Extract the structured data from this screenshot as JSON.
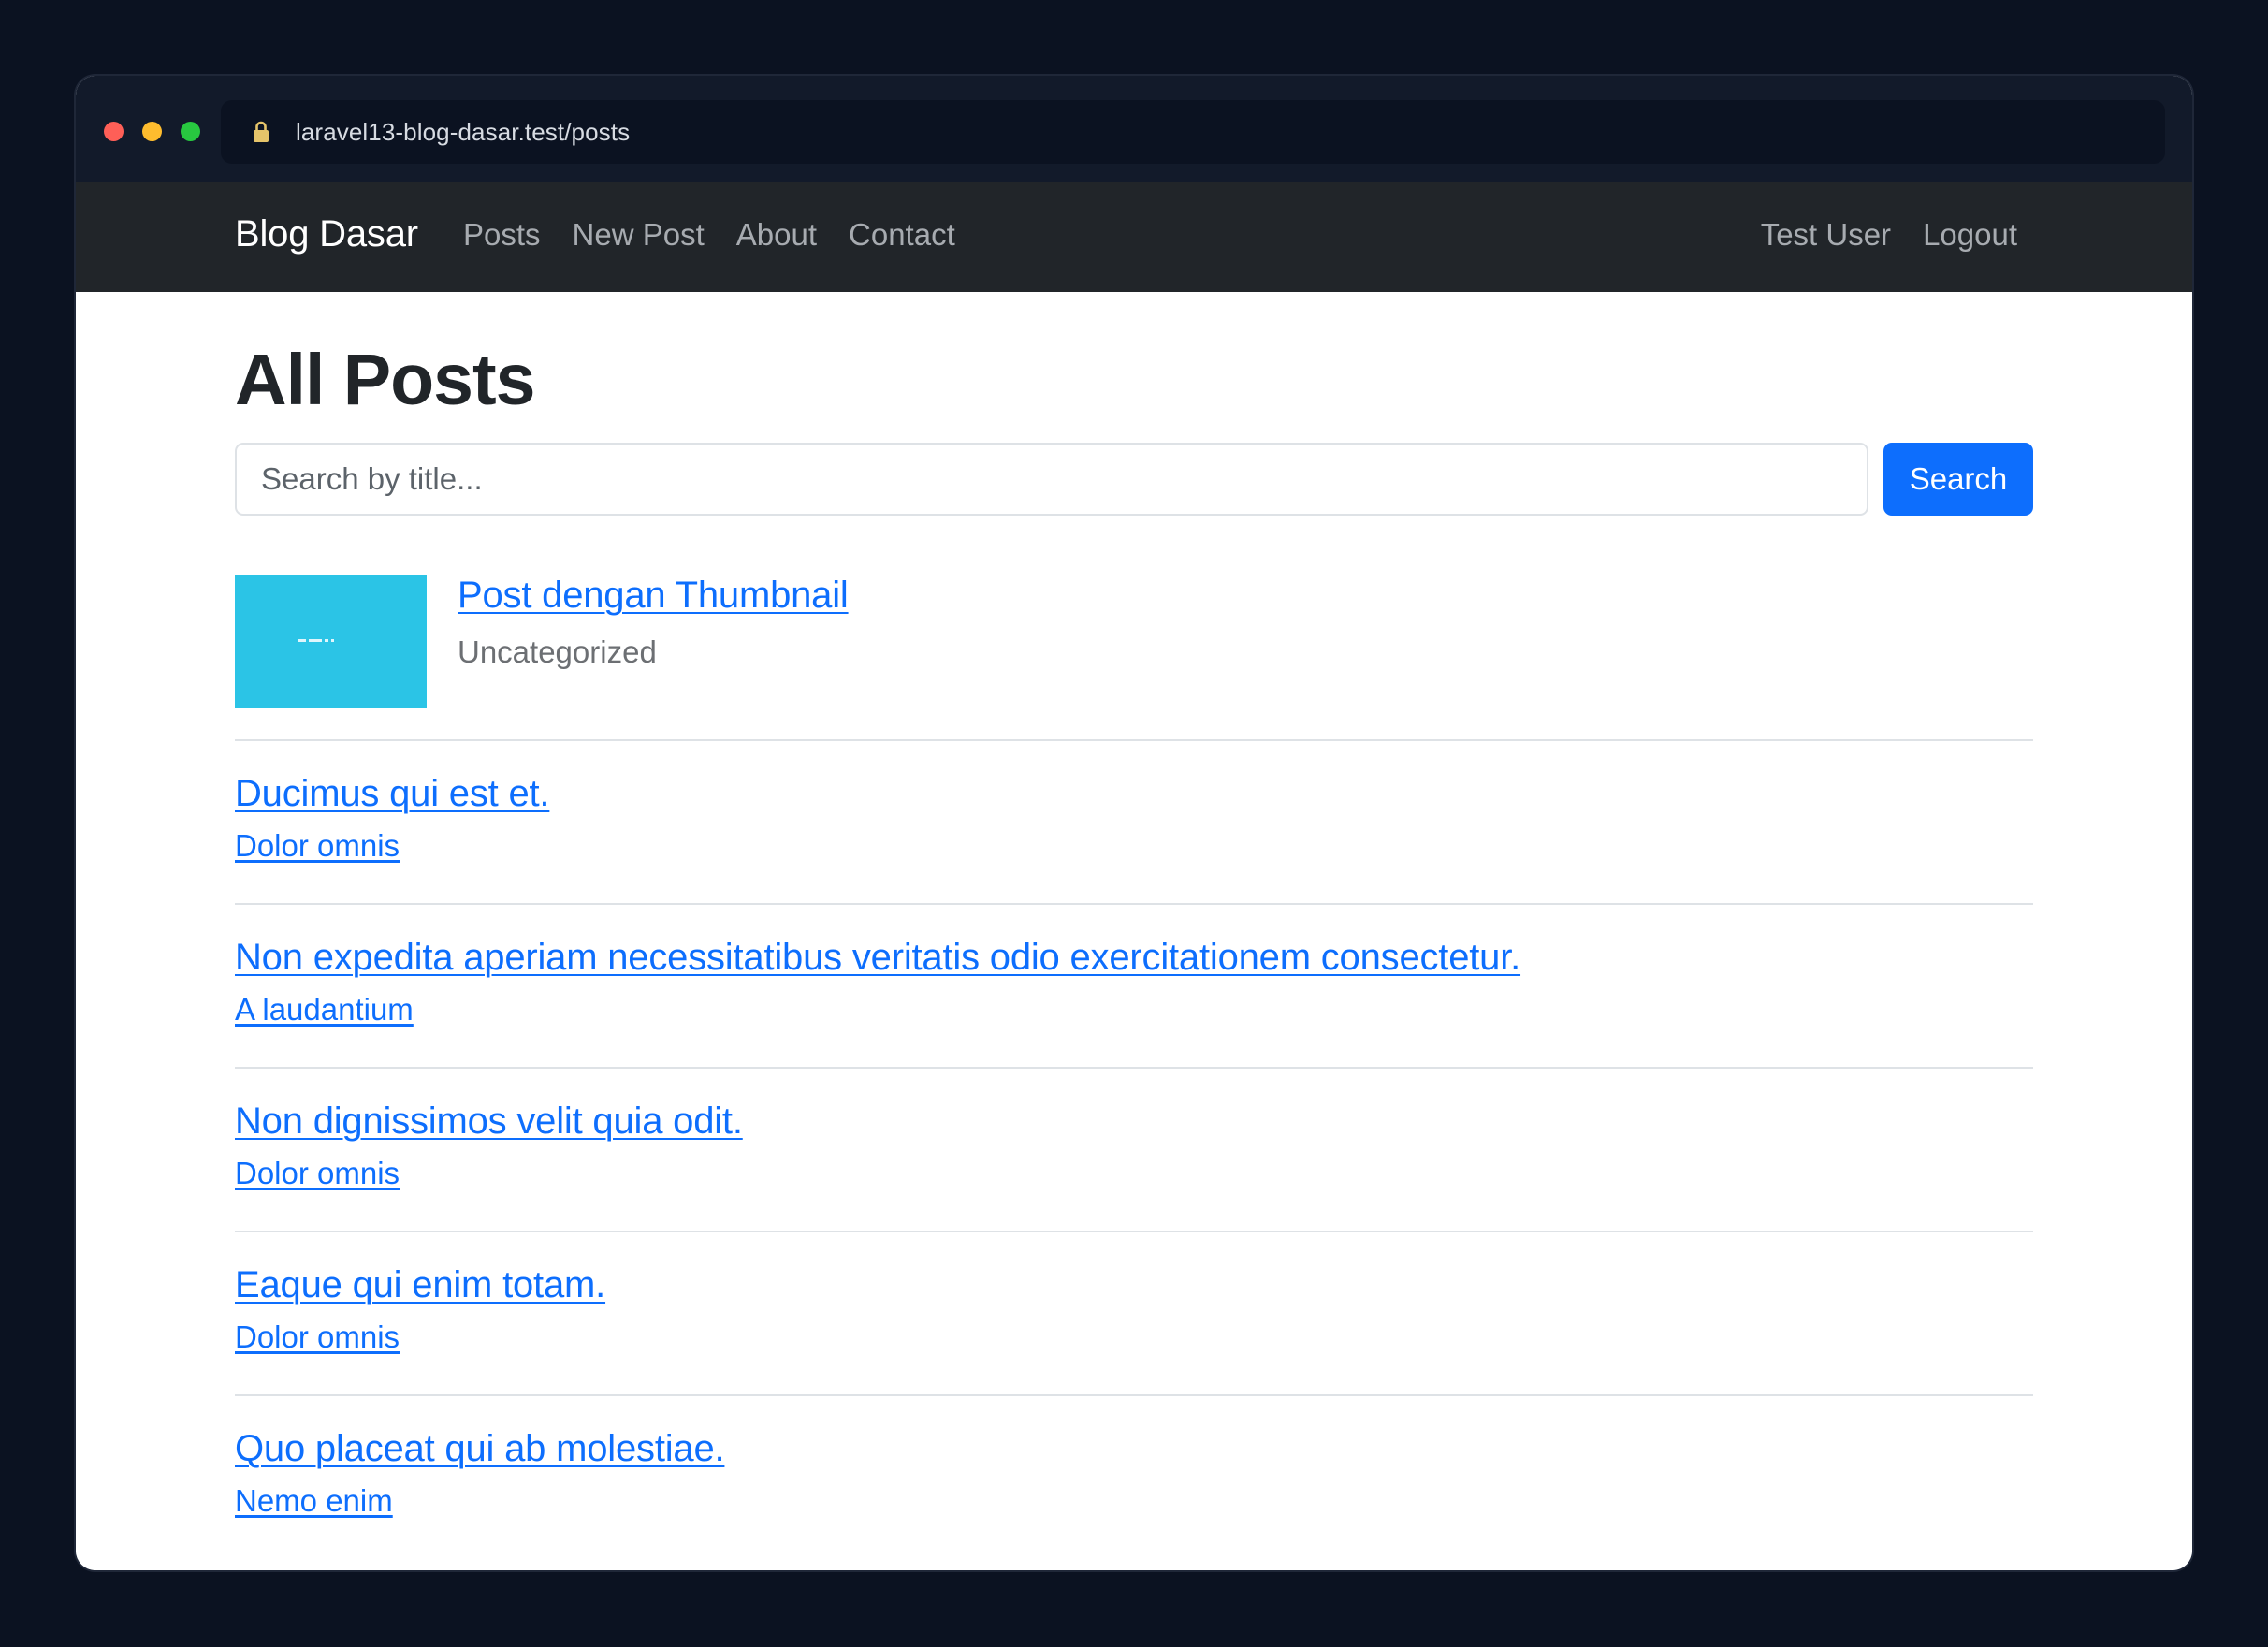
{
  "browser": {
    "url": "laravel13-blog-dasar.test/posts"
  },
  "navbar": {
    "brand": "Blog Dasar",
    "links": [
      {
        "label": "Posts"
      },
      {
        "label": "New Post"
      },
      {
        "label": "About"
      },
      {
        "label": "Contact"
      }
    ],
    "user": {
      "name": "Test User",
      "logout_label": "Logout"
    }
  },
  "main": {
    "title": "All Posts",
    "search": {
      "placeholder": "Search by title...",
      "button_label": "Search"
    },
    "posts": [
      {
        "title": "Post dengan Thumbnail",
        "category": "Uncategorized",
        "has_thumbnail": true,
        "thumbnail_color": "#2bc4e6"
      },
      {
        "title": "Ducimus qui est et.",
        "category": "Dolor omnis"
      },
      {
        "title": "Non expedita aperiam necessitatibus veritatis odio exercitationem consectetur.",
        "category": "A laudantium"
      },
      {
        "title": "Non dignissimos velit quia odit.",
        "category": "Dolor omnis"
      },
      {
        "title": "Eaque qui enim totam.",
        "category": "Dolor omnis"
      },
      {
        "title": "Quo placeat qui ab molestiae.",
        "category": "Nemo enim"
      }
    ]
  },
  "colors": {
    "background": "#0b1221",
    "navbar": "#212529",
    "link": "#0d6efd",
    "button": "#0d6efd",
    "divider": "#dee2e6"
  }
}
